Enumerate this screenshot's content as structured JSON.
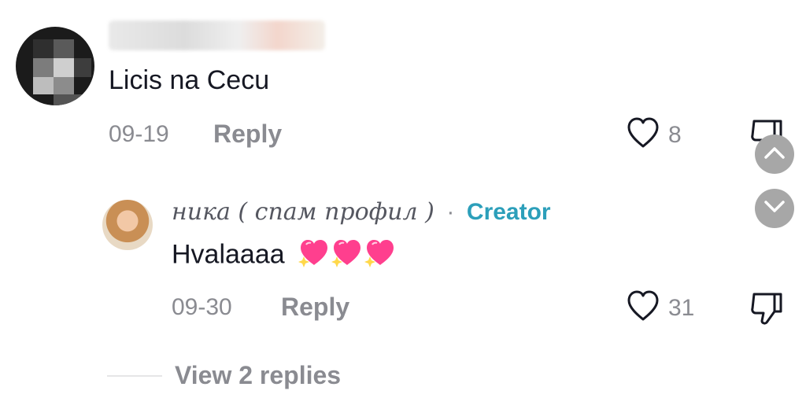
{
  "comment": {
    "text": "Licis na Cecu",
    "date": "09-19",
    "reply_label": "Reply",
    "like_count": "8"
  },
  "reply": {
    "username": "ника ( спам профил )",
    "separator": "·",
    "badge": "Creator",
    "text": "Hvalaaaa",
    "date": "09-30",
    "reply_label": "Reply",
    "like_count": "31"
  },
  "view_replies": {
    "label": "View 2 replies"
  },
  "colors": {
    "text_primary": "#161823",
    "text_secondary": "#8a8b91",
    "creator_badge": "#2c9fba",
    "heart_pink": "#ff3f8e",
    "scroll_button": "#a7a7a7"
  },
  "icons": {
    "heart": "heart-icon",
    "dislike": "thumbs-down-icon",
    "scroll_up": "chevron-up-icon",
    "scroll_down": "chevron-down-icon",
    "emoji": "sparkling-heart-icon"
  }
}
